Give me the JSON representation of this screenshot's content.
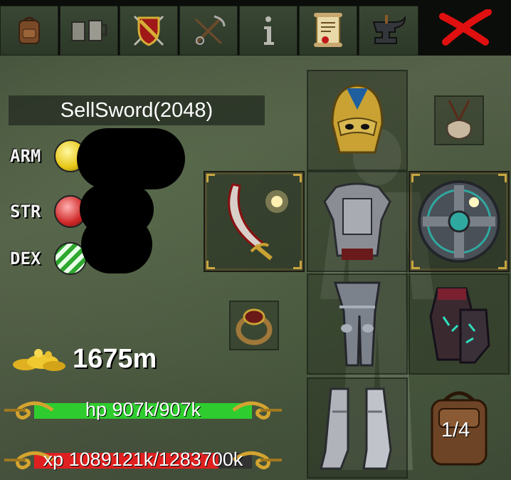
{
  "tabs": [
    {
      "id": "inventory",
      "icon": "backpack-icon"
    },
    {
      "id": "tavern",
      "icon": "mugs-icon"
    },
    {
      "id": "guild",
      "icon": "shield-crest-icon"
    },
    {
      "id": "skills",
      "icon": "crossed-tools-icon"
    },
    {
      "id": "info",
      "icon": "info-icon"
    },
    {
      "id": "quests",
      "icon": "scroll-icon"
    },
    {
      "id": "forge",
      "icon": "anvil-icon"
    }
  ],
  "close": {
    "icon": "close-x-icon"
  },
  "player": {
    "name": "SellSword(2048)"
  },
  "stats": {
    "arm_label": "ARM",
    "str_label": "STR",
    "dex_label": "DEX"
  },
  "gold": {
    "value": "1675m"
  },
  "hp": {
    "text": "hp 907k/907k",
    "fraction": 1.0,
    "color": "#2ecc2e"
  },
  "xp": {
    "text": "xp 1089121k/1283700k",
    "fraction": 0.848,
    "color": "#e02020"
  },
  "equipment": {
    "helmet": "golden-helmet-icon",
    "amulet": "amulet-icon",
    "weapon": "curved-sword-icon",
    "armor": "plate-armor-icon",
    "offhand": "round-shield-icon",
    "ring": "ring-icon",
    "legs": "leg-armor-icon",
    "gloves": "gauntlets-icon",
    "boots": "boots-icon",
    "bag_count": "1/4"
  },
  "colors": {
    "accent_gold": "#c9a640",
    "close_red": "#e01010"
  }
}
